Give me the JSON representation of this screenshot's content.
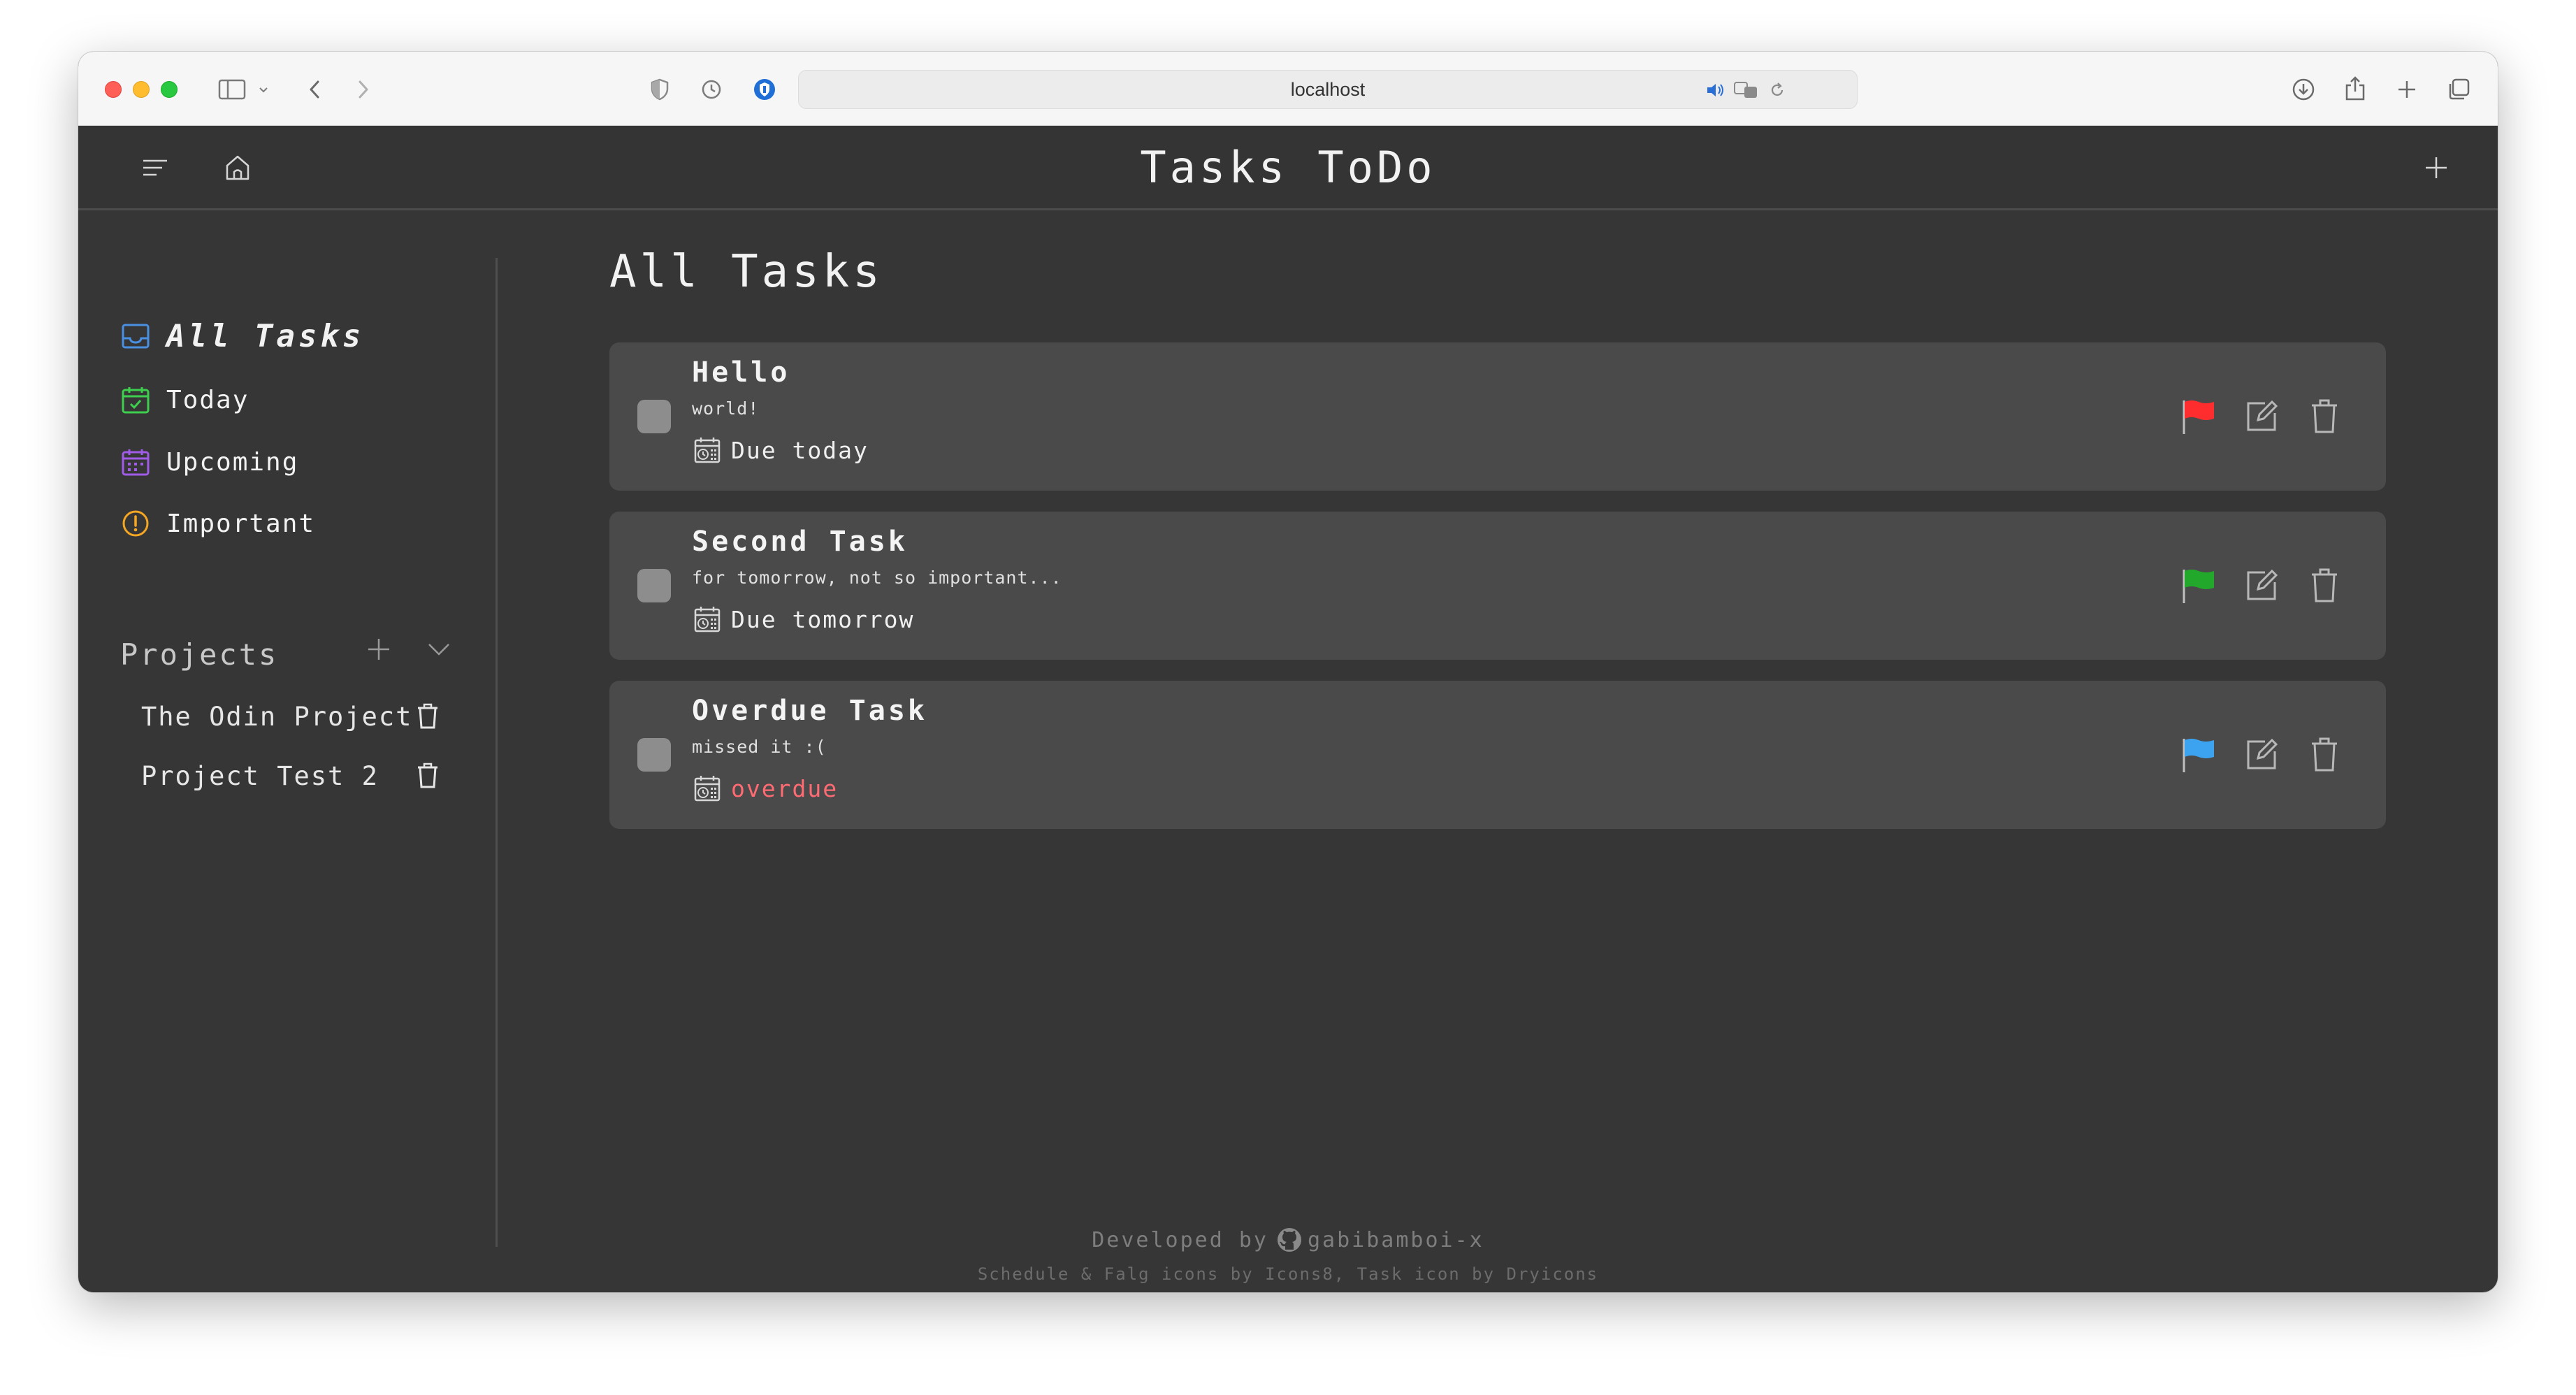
{
  "browser": {
    "url": "localhost"
  },
  "app": {
    "title": "Tasks ToDo"
  },
  "sidebar": {
    "nav": [
      {
        "label": "All Tasks",
        "icon": "inbox-icon",
        "color": "#4a90e2"
      },
      {
        "label": "Today",
        "icon": "calendar-check-icon",
        "color": "#3ecf4f"
      },
      {
        "label": "Upcoming",
        "icon": "calendar-icon",
        "color": "#a05ce8"
      },
      {
        "label": "Important",
        "icon": "alert-circle-icon",
        "color": "#f5a623"
      }
    ],
    "projects_heading": "Projects",
    "projects": [
      {
        "label": "The Odin Project"
      },
      {
        "label": "Project Test 2"
      }
    ]
  },
  "main": {
    "page_title": "All Tasks",
    "tasks": [
      {
        "title": "Hello",
        "description": "world!",
        "due": "Due today",
        "flag_color": "#ff2d2d",
        "overdue": false
      },
      {
        "title": "Second Task",
        "description": "for tomorrow, not so important...",
        "due": "Due tomorrow",
        "flag_color": "#22a82a",
        "overdue": false
      },
      {
        "title": "Overdue Task",
        "description": "missed it :(",
        "due": "overdue",
        "flag_color": "#3ba3f0",
        "overdue": true
      }
    ]
  },
  "footer": {
    "developed_by": "Developed by",
    "author": "gabibamboi-x",
    "credits": "Schedule & Falg icons by Icons8, Task icon by Dryicons"
  },
  "colors": {
    "overdue_text": "#ff6b73",
    "app_bg": "#363636",
    "card_bg": "#4a4a4a"
  }
}
